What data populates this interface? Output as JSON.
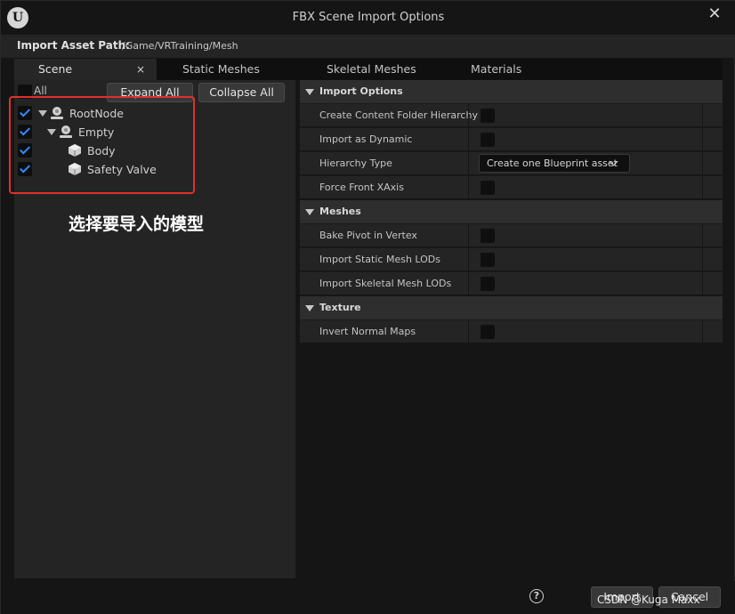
{
  "window": {
    "title": "FBX Scene Import Options"
  },
  "path": {
    "label": "Import Asset Path:",
    "value": "/Game/VRTraining/Mesh"
  },
  "tabs": [
    {
      "label": "Scene",
      "active": true
    },
    {
      "label": "Static Meshes",
      "active": false
    },
    {
      "label": "Skeletal Meshes",
      "active": false
    },
    {
      "label": "Materials",
      "active": false
    }
  ],
  "tab_close_glyph": "×",
  "scene": {
    "all_label": "All",
    "expand_all_label": "Expand All",
    "collapse_all_label": "Collapse All",
    "tree": [
      {
        "label": "RootNode",
        "checked": true,
        "icon": "scene-node-icon"
      },
      {
        "label": "Empty",
        "checked": true,
        "icon": "scene-node-icon"
      },
      {
        "label": "Body",
        "checked": true,
        "icon": "static-mesh-icon"
      },
      {
        "label": "Safety Valve",
        "checked": true,
        "icon": "static-mesh-icon"
      }
    ],
    "annotation": "选择要导入的模型"
  },
  "details": {
    "sections": [
      {
        "title": "Import Options",
        "props": [
          {
            "label": "Create Content Folder Hierarchy"
          },
          {
            "label": "Import as Dynamic"
          },
          {
            "label": "Hierarchy Type",
            "combo": "Create one Blueprint asset"
          },
          {
            "label": "Force Front XAxis"
          }
        ]
      },
      {
        "title": "Meshes",
        "props": [
          {
            "label": "Bake Pivot in Vertex"
          },
          {
            "label": "Import Static Mesh LODs"
          },
          {
            "label": "Import Skeletal Mesh LODs"
          }
        ]
      },
      {
        "title": "Texture",
        "props": [
          {
            "label": "Invert Normal Maps"
          }
        ]
      }
    ]
  },
  "footer": {
    "help_glyph": "?",
    "import_label": "Import",
    "cancel_label": "Cancel",
    "watermark": "CSDN @Kuga Maxx"
  },
  "colors": {
    "accent_check": "#2f8cff",
    "annotation_box": "#e0302a"
  }
}
